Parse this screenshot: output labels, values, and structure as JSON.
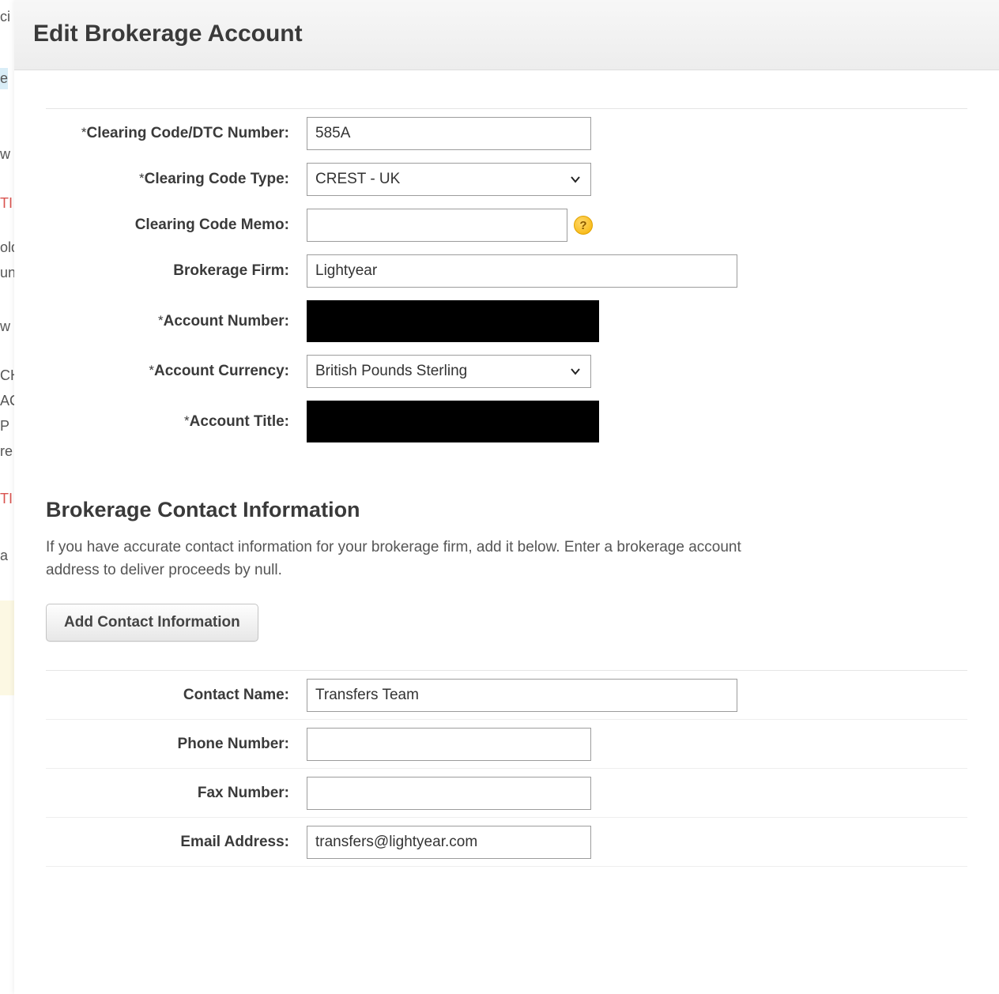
{
  "header": {
    "title": "Edit Brokerage Account"
  },
  "form": {
    "clearing_code": {
      "label": "Clearing Code/DTC Number:",
      "required": true,
      "value": "585A"
    },
    "clearing_code_type": {
      "label": "Clearing Code Type:",
      "required": true,
      "value": "CREST - UK"
    },
    "clearing_code_memo": {
      "label": "Clearing Code Memo:",
      "required": false,
      "value": "",
      "help_symbol": "?"
    },
    "brokerage_firm": {
      "label": "Brokerage Firm:",
      "required": false,
      "value": "Lightyear"
    },
    "account_number": {
      "label": "Account Number:",
      "required": true,
      "redacted": true
    },
    "account_currency": {
      "label": "Account Currency:",
      "required": true,
      "value": "British Pounds Sterling"
    },
    "account_title": {
      "label": "Account Title:",
      "required": true,
      "redacted": true
    }
  },
  "contact_section": {
    "title": "Brokerage Contact Information",
    "description": "If you have accurate contact information for your brokerage firm, add it below. Enter a brokerage account address to deliver proceeds by null.",
    "add_btn_label": "Add Contact Information",
    "fields": {
      "contact_name": {
        "label": "Contact Name:",
        "value": "Transfers Team"
      },
      "phone_number": {
        "label": "Phone Number:",
        "value": ""
      },
      "fax_number": {
        "label": "Fax Number:",
        "value": ""
      },
      "email_address": {
        "label": "Email Address:",
        "value": "transfers@lightyear.com"
      }
    }
  },
  "bg_sliver": [
    "ci",
    "e",
    "w",
    "TI",
    "old",
    "un",
    "w",
    "CH",
    "AC",
    "P",
    "re",
    "TI",
    "a"
  ]
}
